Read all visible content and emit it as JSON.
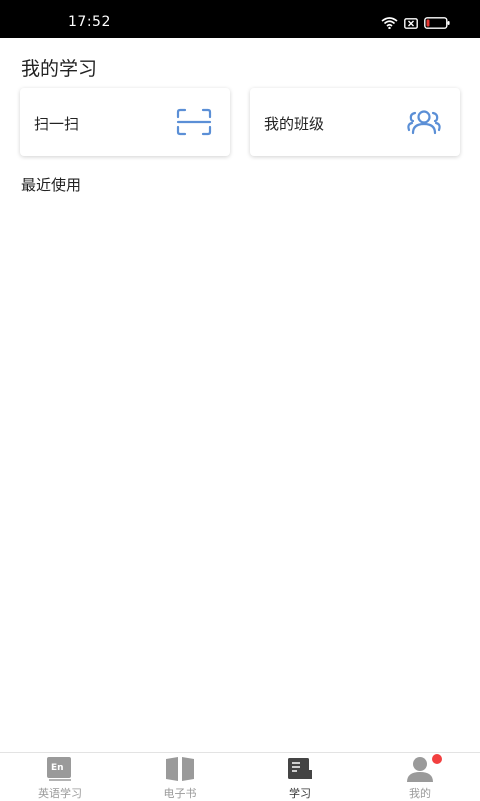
{
  "status_bar": {
    "time": "17:52"
  },
  "header": {
    "title": "我的学习"
  },
  "cards": [
    {
      "label": "扫一扫",
      "icon": "scan-icon"
    },
    {
      "label": "我的班级",
      "icon": "group-icon"
    }
  ],
  "recent": {
    "title": "最近使用"
  },
  "tabs": [
    {
      "label": "英语学习",
      "icon": "english-book-icon"
    },
    {
      "label": "电子书",
      "icon": "open-book-icon"
    },
    {
      "label": "学习",
      "icon": "study-icon",
      "active": true
    },
    {
      "label": "我的",
      "icon": "user-icon",
      "badge": true
    }
  ],
  "colors": {
    "accent": "#5b8fd6",
    "badge": "#f23f3f",
    "tab_inactive": "#9a9a9a"
  }
}
